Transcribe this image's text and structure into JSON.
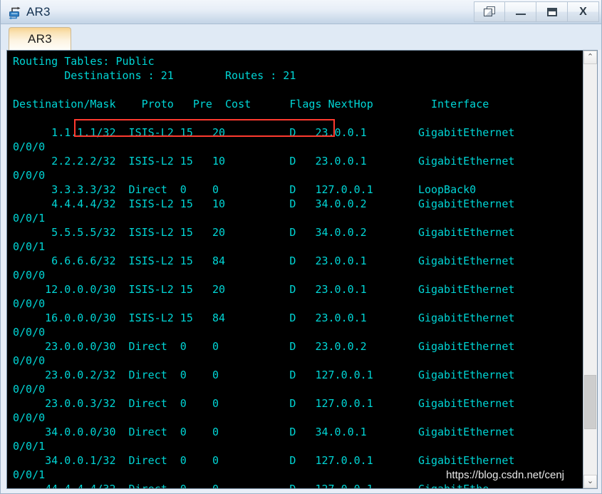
{
  "window": {
    "title": "AR3",
    "icon": "router-icon",
    "controls": [
      {
        "name": "restore-windows-button",
        "icon": "restore-icon",
        "label": ""
      },
      {
        "name": "minimize-button",
        "icon": "minimize-icon",
        "label": ""
      },
      {
        "name": "maximize-button",
        "icon": "maximize-icon",
        "label": ""
      },
      {
        "name": "close-button",
        "icon": "close-icon",
        "label": "X"
      }
    ]
  },
  "tabs": [
    {
      "label": "AR3",
      "active": true
    }
  ],
  "terminal": {
    "heading": "Routing Tables: Public",
    "summary": {
      "destinations_label": "Destinations",
      "destinations_value": "21",
      "routes_label": "Routes",
      "routes_value": "21",
      "line": "        Destinations : 21        Routes : 21",
      "highlight_color": "#ff3a2f"
    },
    "columns": [
      "Destination/Mask",
      "Proto",
      "Pre",
      "Cost",
      "Flags",
      "NextHop",
      "Interface"
    ],
    "header_line": "Destination/Mask    Proto   Pre  Cost      Flags NextHop         Interface",
    "rows": [
      {
        "destination": "1.1.1.1/32",
        "proto": "ISIS-L2",
        "pre": "15",
        "cost": "20",
        "flags": "D",
        "nexthop": "23.0.0.1",
        "interface": "GigabitEthernet",
        "interface_cont": "0/0/0"
      },
      {
        "destination": "2.2.2.2/32",
        "proto": "ISIS-L2",
        "pre": "15",
        "cost": "10",
        "flags": "D",
        "nexthop": "23.0.0.1",
        "interface": "GigabitEthernet",
        "interface_cont": "0/0/0"
      },
      {
        "destination": "3.3.3.3/32",
        "proto": "Direct",
        "pre": "0",
        "cost": "0",
        "flags": "D",
        "nexthop": "127.0.0.1",
        "interface": "LoopBack0",
        "interface_cont": ""
      },
      {
        "destination": "4.4.4.4/32",
        "proto": "ISIS-L2",
        "pre": "15",
        "cost": "10",
        "flags": "D",
        "nexthop": "34.0.0.2",
        "interface": "GigabitEthernet",
        "interface_cont": "0/0/1"
      },
      {
        "destination": "5.5.5.5/32",
        "proto": "ISIS-L2",
        "pre": "15",
        "cost": "20",
        "flags": "D",
        "nexthop": "34.0.0.2",
        "interface": "GigabitEthernet",
        "interface_cont": "0/0/1"
      },
      {
        "destination": "6.6.6.6/32",
        "proto": "ISIS-L2",
        "pre": "15",
        "cost": "84",
        "flags": "D",
        "nexthop": "23.0.0.1",
        "interface": "GigabitEthernet",
        "interface_cont": "0/0/0"
      },
      {
        "destination": "12.0.0.0/30",
        "proto": "ISIS-L2",
        "pre": "15",
        "cost": "20",
        "flags": "D",
        "nexthop": "23.0.0.1",
        "interface": "GigabitEthernet",
        "interface_cont": "0/0/0"
      },
      {
        "destination": "16.0.0.0/30",
        "proto": "ISIS-L2",
        "pre": "15",
        "cost": "84",
        "flags": "D",
        "nexthop": "23.0.0.1",
        "interface": "GigabitEthernet",
        "interface_cont": "0/0/0"
      },
      {
        "destination": "23.0.0.0/30",
        "proto": "Direct",
        "pre": "0",
        "cost": "0",
        "flags": "D",
        "nexthop": "23.0.0.2",
        "interface": "GigabitEthernet",
        "interface_cont": "0/0/0"
      },
      {
        "destination": "23.0.0.2/32",
        "proto": "Direct",
        "pre": "0",
        "cost": "0",
        "flags": "D",
        "nexthop": "127.0.0.1",
        "interface": "GigabitEthernet",
        "interface_cont": "0/0/0"
      },
      {
        "destination": "23.0.0.3/32",
        "proto": "Direct",
        "pre": "0",
        "cost": "0",
        "flags": "D",
        "nexthop": "127.0.0.1",
        "interface": "GigabitEthernet",
        "interface_cont": "0/0/0"
      },
      {
        "destination": "34.0.0.0/30",
        "proto": "Direct",
        "pre": "0",
        "cost": "0",
        "flags": "D",
        "nexthop": "34.0.0.1",
        "interface": "GigabitEthernet",
        "interface_cont": "0/0/1"
      },
      {
        "destination": "34.0.0.1/32",
        "proto": "Direct",
        "pre": "0",
        "cost": "0",
        "flags": "D",
        "nexthop": "127.0.0.1",
        "interface": "GigabitEthernet",
        "interface_cont": "0/0/1"
      }
    ],
    "text": "Routing Tables: Public\n        Destinations : 21        Routes : 21\n\nDestination/Mask    Proto   Pre  Cost      Flags NextHop         Interface\n\n      1.1.1.1/32  ISIS-L2 15   20          D   23.0.0.1        GigabitEthernet\n0/0/0\n      2.2.2.2/32  ISIS-L2 15   10          D   23.0.0.1        GigabitEthernet\n0/0/0\n      3.3.3.3/32  Direct  0    0           D   127.0.0.1       LoopBack0\n      4.4.4.4/32  ISIS-L2 15   10          D   34.0.0.2        GigabitEthernet\n0/0/1\n      5.5.5.5/32  ISIS-L2 15   20          D   34.0.0.2        GigabitEthernet\n0/0/1\n      6.6.6.6/32  ISIS-L2 15   84          D   23.0.0.1        GigabitEthernet\n0/0/0\n     12.0.0.0/30  ISIS-L2 15   20          D   23.0.0.1        GigabitEthernet\n0/0/0\n     16.0.0.0/30  ISIS-L2 15   84          D   23.0.0.1        GigabitEthernet\n0/0/0\n     23.0.0.0/30  Direct  0    0           D   23.0.0.2        GigabitEthernet\n0/0/0\n     23.0.0.2/32  Direct  0    0           D   127.0.0.1       GigabitEthernet\n0/0/0\n     23.0.0.3/32  Direct  0    0           D   127.0.0.1       GigabitEthernet\n0/0/0\n     34.0.0.0/30  Direct  0    0           D   34.0.0.1        GigabitEthernet\n0/0/1\n     34.0.0.1/32  Direct  0    0           D   127.0.0.1       GigabitEthernet\n0/0/1\n     44.4.4.4/32  Direct  0    0           D   127.0.0.1       GigabitEthe",
    "colors": {
      "background": "#000000",
      "text": "#00d5d5"
    }
  },
  "scrollbar": {
    "up_arrow": "⌃",
    "down_arrow": "⌄"
  },
  "watermark": {
    "text": "https://blog.csdn.net/cenj"
  }
}
